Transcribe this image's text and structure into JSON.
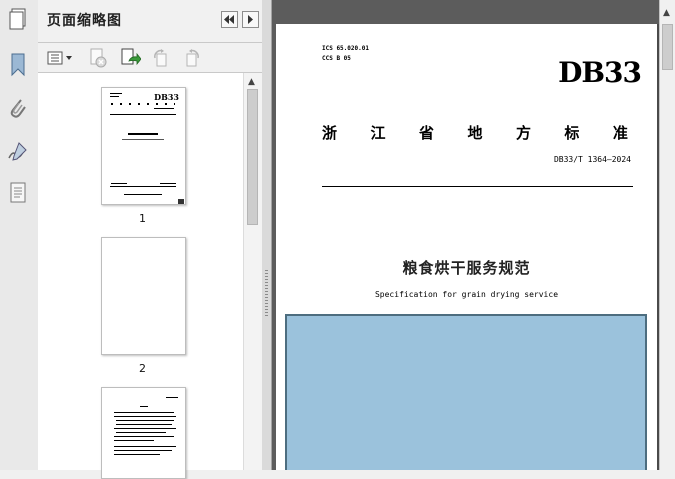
{
  "panel": {
    "title": "页面缩略图",
    "header_buttons": [
      "collapse-left-icon",
      "expand-right-icon"
    ],
    "toolbar_icons": [
      "options-menu-icon",
      "delete-page-icon",
      "insert-page-icon",
      "rotate-left-icon",
      "rotate-right-icon"
    ]
  },
  "rail": {
    "icons": [
      "bookmark-icon",
      "attachment-icon",
      "signature-icon",
      "page-layers-icon"
    ]
  },
  "thumbnails": [
    {
      "label": "1",
      "selected": true
    },
    {
      "label": "2",
      "selected": false
    },
    {
      "label": "",
      "selected": false
    }
  ],
  "document": {
    "ics": "ICS 65.020.01",
    "ccs": "CCS B 05",
    "logo": "DB33",
    "province": [
      "浙",
      "江",
      "省",
      "地",
      "方",
      "标",
      "准"
    ],
    "standard_number": "DB33/T 1364—2024",
    "title_cn": "粮食烘干服务规范",
    "title_en": "Specification for grain drying service"
  },
  "colors": {
    "selection_fill": "#9bc2dc",
    "selection_border": "#4d6d7f",
    "viewer_background": "#5c5c5c"
  }
}
